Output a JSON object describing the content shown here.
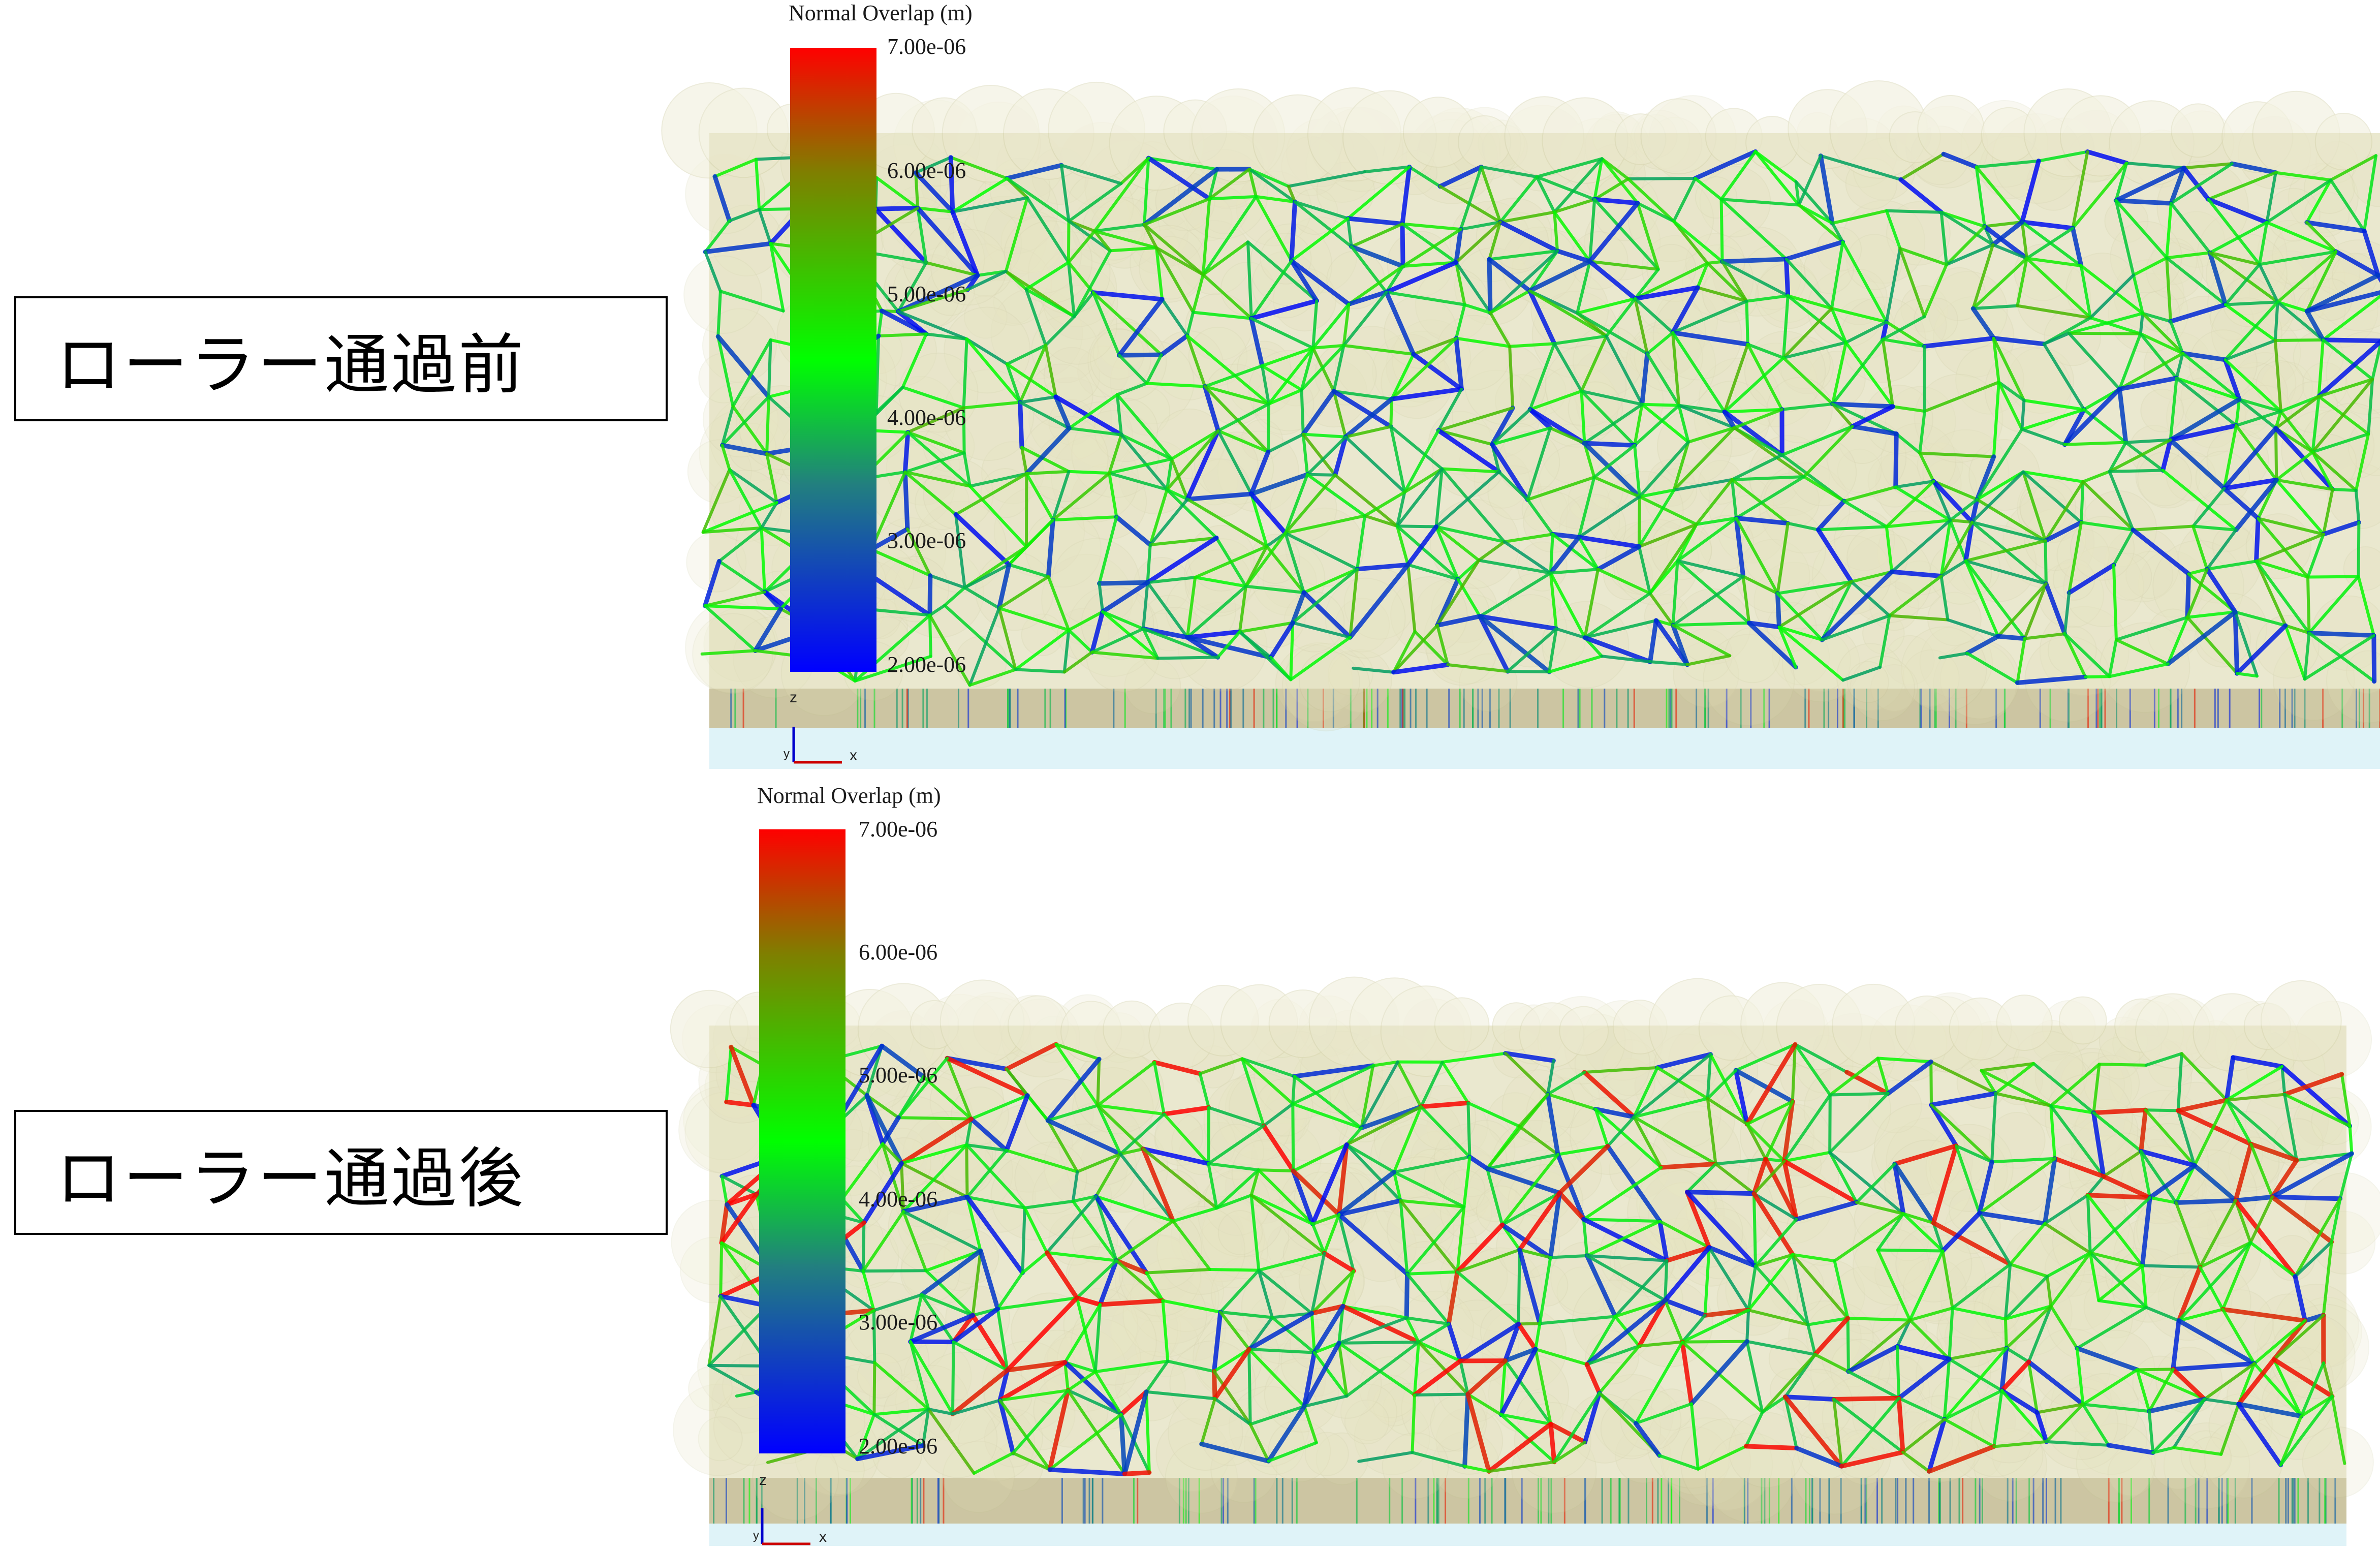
{
  "panels": [
    {
      "label": "ローラー通過前",
      "colorbar": {
        "title": "Normal Overlap (m)",
        "ticks": [
          "7.00e-06",
          "6.00e-06",
          "5.00e-06",
          "4.00e-06",
          "3.00e-06",
          "2.00e-06"
        ]
      },
      "axes": {
        "z": "z",
        "y": "y",
        "x": "x"
      },
      "compressed": false
    },
    {
      "label": "ローラー通過後",
      "colorbar": {
        "title": "Normal Overlap (m)",
        "ticks": [
          "7.00e-06",
          "6.00e-06",
          "5.00e-06",
          "4.00e-06",
          "3.00e-06",
          "2.00e-06"
        ]
      },
      "axes": {
        "z": "z",
        "y": "y",
        "x": "x"
      },
      "compressed": true
    }
  ],
  "colors": {
    "low": "#0000ff",
    "mid": "#00ff00",
    "high": "#ff0000",
    "particle": "#d8d6a8",
    "substrate": "#ccc5a2",
    "base": "#dff3f8"
  }
}
